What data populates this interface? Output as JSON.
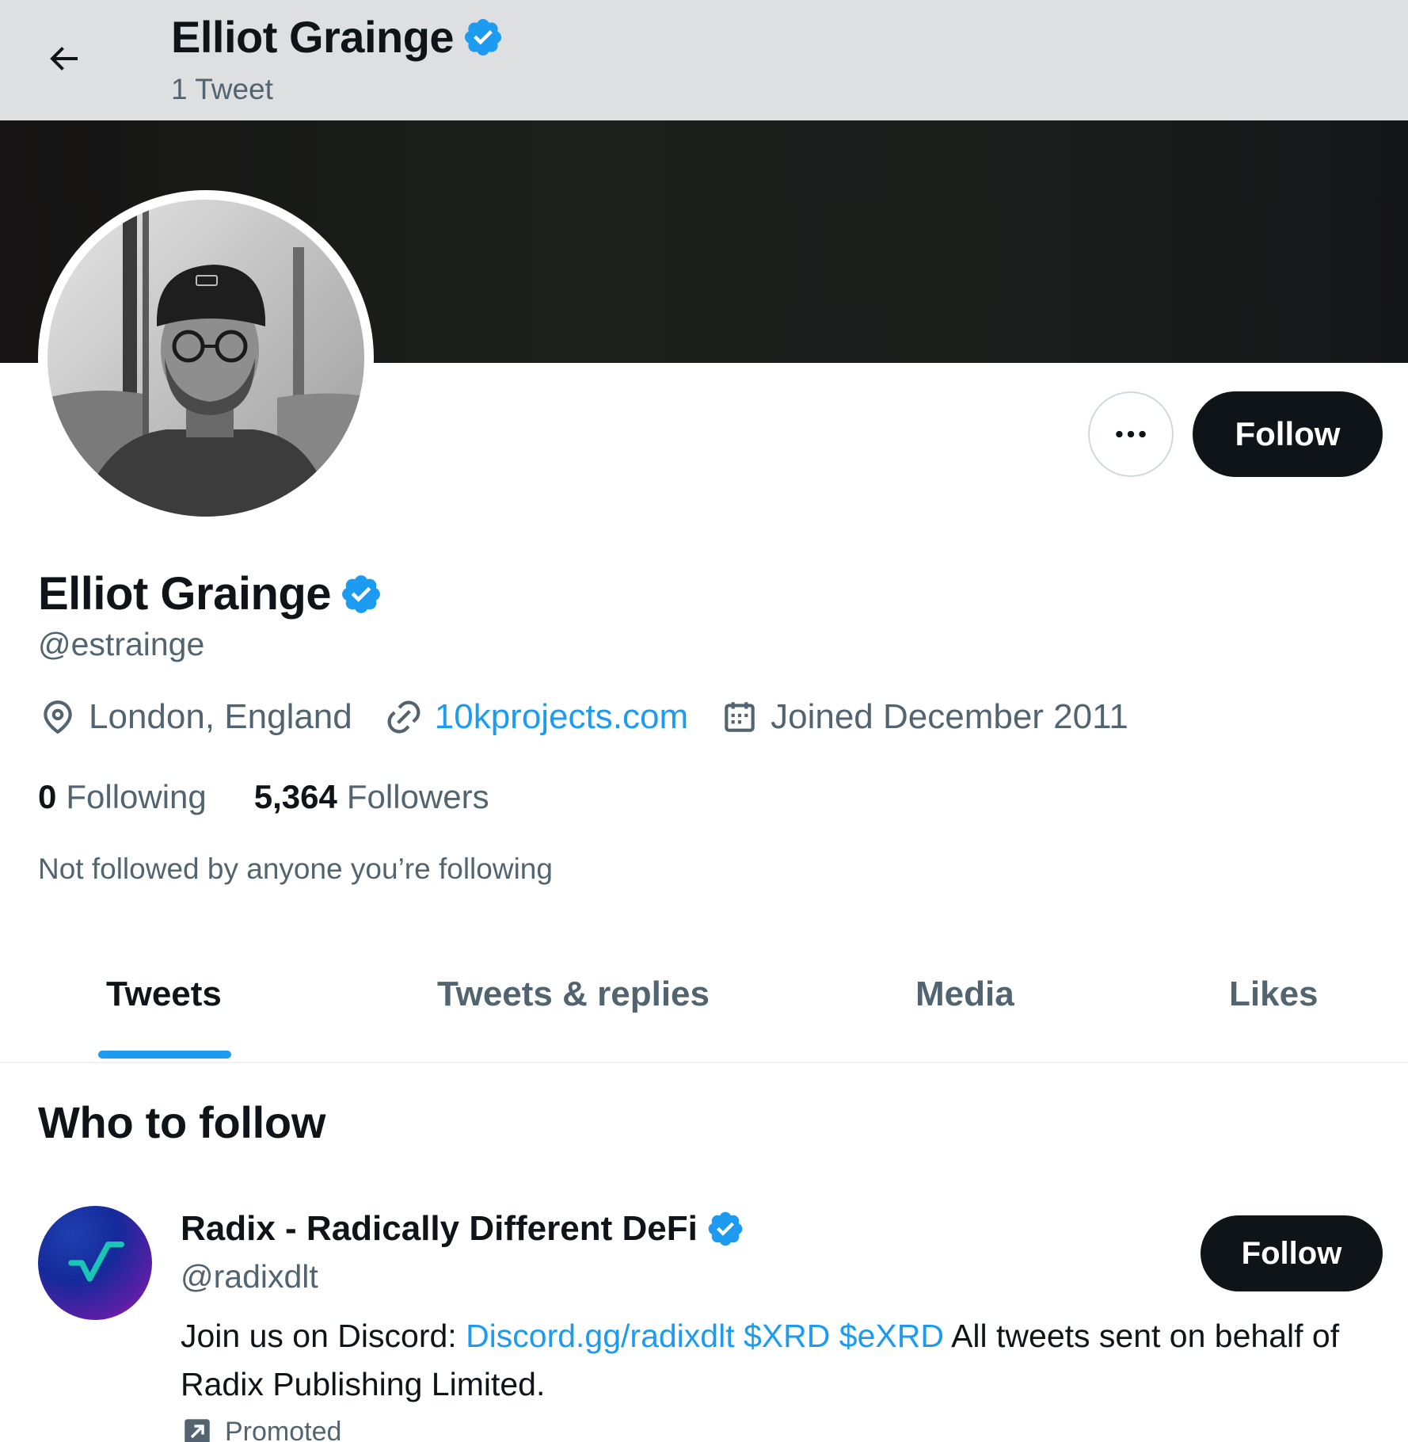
{
  "header": {
    "title": "Elliot Grainge",
    "subtitle": "1 Tweet",
    "back_icon": "arrow-left-icon"
  },
  "profile": {
    "name": "Elliot Grainge",
    "handle": "@estrainge",
    "verified": true,
    "location": "London, England",
    "website": "10kprojects.com",
    "joined": "Joined December 2011",
    "following_count": "0",
    "following_label": "Following",
    "followers_count": "5,364",
    "followers_label": "Followers",
    "not_followed_text": "Not followed by anyone you’re following"
  },
  "actions": {
    "more_icon": "more-horizontal-icon",
    "follow_label": "Follow"
  },
  "tabs": [
    {
      "label": "Tweets",
      "active": true
    },
    {
      "label": "Tweets & replies",
      "active": false
    },
    {
      "label": "Media",
      "active": false
    },
    {
      "label": "Likes",
      "active": false
    }
  ],
  "who_to_follow": {
    "title": "Who to follow",
    "suggestion": {
      "name": "Radix - Radically Different DeFi",
      "handle": "@radixdlt",
      "verified": true,
      "follow_label": "Follow",
      "bio_prefix": "Join us on Discord: ",
      "bio_link": "Discord.gg/radixdlt",
      "bio_tag1": "$XRD",
      "bio_tag2": "$eXRD",
      "bio_suffix": " All tweets sent on behalf of Radix Publishing Limited.",
      "promoted_label": "Promoted"
    }
  },
  "colors": {
    "accent": "#1d9bf0",
    "text_primary": "#0f1419",
    "text_secondary": "#536471",
    "header_bg": "#dedfe0"
  }
}
